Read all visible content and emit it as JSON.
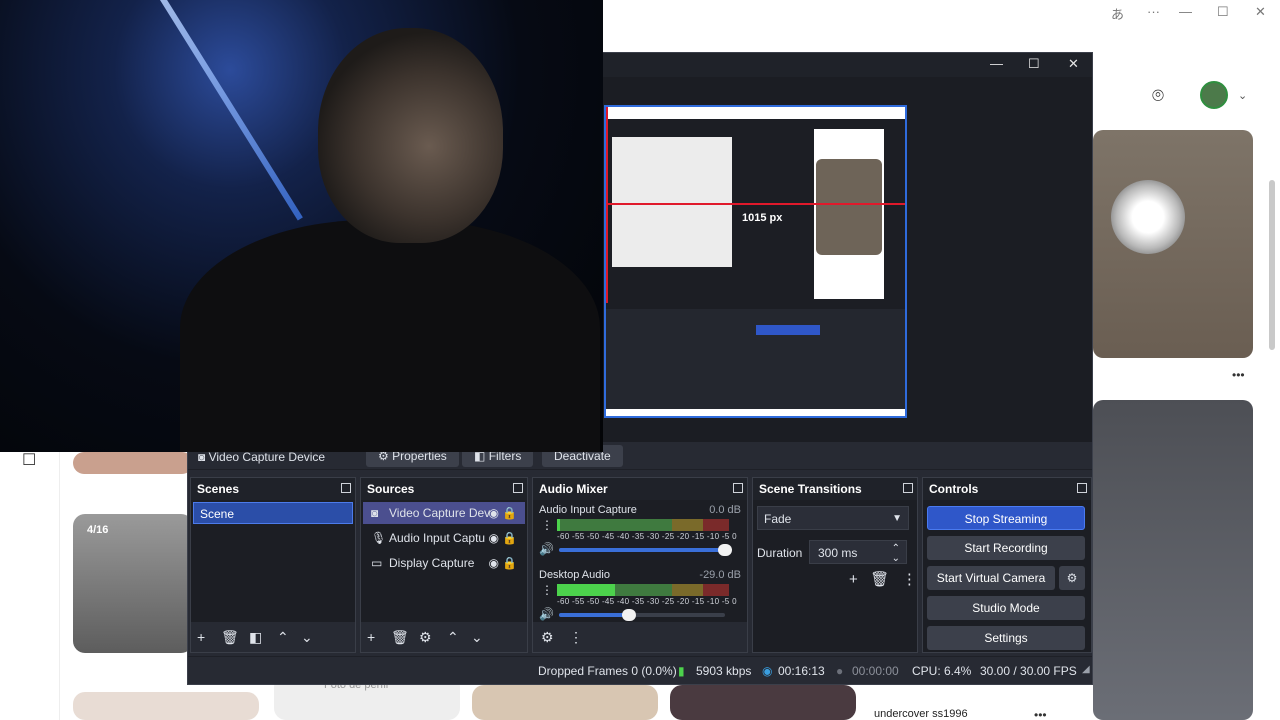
{
  "browser": {
    "pin_caption": "undercover ss1996",
    "pin_counter": "4/16",
    "pin_placeholder": "Foto de perfil",
    "more_glyph": "•••"
  },
  "obs": {
    "preview_label": "1015 px",
    "context_bar": {
      "source": "Video Capture Device",
      "properties": "Properties",
      "filters": "Filters",
      "deactivate": "Deactivate"
    },
    "scenes": {
      "title": "Scenes",
      "items": [
        "Scene"
      ]
    },
    "sources": {
      "title": "Sources",
      "items": [
        {
          "label": "Video Capture Dev",
          "icon": "camera-icon"
        },
        {
          "label": "Audio Input Captu",
          "icon": "microphone-icon"
        },
        {
          "label": "Display Capture",
          "icon": "monitor-icon"
        }
      ]
    },
    "mixer": {
      "title": "Audio Mixer",
      "scale": "-60 -55 -50 -45 -40 -35 -30 -25 -20 -15 -10  -5   0",
      "channels": [
        {
          "name": "Audio Input Capture",
          "db": "0.0 dB",
          "level": 0.02,
          "volume": 1.0
        },
        {
          "name": "Desktop Audio",
          "db": "-29.0 dB",
          "level": 0.34,
          "volume": 0.42
        }
      ]
    },
    "transitions": {
      "title": "Scene Transitions",
      "selected": "Fade",
      "duration_label": "Duration",
      "duration_value": "300 ms"
    },
    "controls": {
      "title": "Controls",
      "stop_streaming": "Stop Streaming",
      "start_recording": "Start Recording",
      "start_virtual_camera": "Start Virtual Camera",
      "studio_mode": "Studio Mode",
      "settings": "Settings"
    },
    "status": {
      "dropped_frames": "Dropped Frames 0 (0.0%)",
      "bitrate": "5903 kbps",
      "stream_time": "00:16:13",
      "record_time": "00:00:00",
      "cpu": "CPU: 6.4%",
      "fps": "30.00 / 30.00 FPS"
    }
  },
  "colors": {
    "accent": "#2f57c9",
    "panel": "#272a33",
    "dock": "#1f2229",
    "meter_green": "#4cd24c",
    "bitrate_green": "#4cd24c"
  }
}
